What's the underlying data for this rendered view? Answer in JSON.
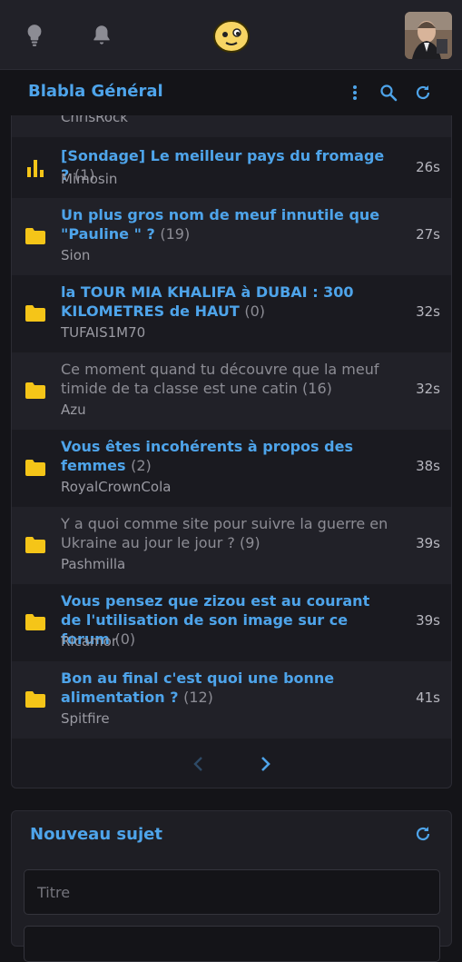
{
  "header": {
    "logo_icon": "smiley-face-icon",
    "idea_icon": "lightbulb-icon",
    "notif_icon": "bell-icon",
    "avatar": "user-avatar"
  },
  "forum": {
    "title": "Blabla Général",
    "menu_icon": "more-vertical-icon",
    "search_icon": "search-icon",
    "refresh_icon": "refresh-icon"
  },
  "topics": [
    {
      "icon": "folder-icon",
      "title": "",
      "count": "",
      "author": "ChrisRock",
      "time": "",
      "visited": false,
      "partial": true
    },
    {
      "icon": "poll-icon",
      "title": "[Sondage] Le meilleur pays du fromage ?",
      "count": "(1)",
      "author": "Mimosin",
      "time": "26s",
      "visited": false
    },
    {
      "icon": "folder-icon",
      "title": "Un plus gros nom de meuf innutile que \"Pauline \" ?",
      "count": "(19)",
      "author": "Sion",
      "time": "27s",
      "visited": false
    },
    {
      "icon": "folder-icon",
      "title": "la TOUR MIA KHALIFA à DUBAI : 300 KILOMETRES de HAUT",
      "count": "(0)",
      "author": "TUFAIS1M70",
      "time": "32s",
      "visited": false
    },
    {
      "icon": "folder-icon",
      "title": "Ce moment quand tu découvre que la meuf timide de ta classe est une catin",
      "count": "(16)",
      "author": "Azu",
      "time": "32s",
      "visited": true
    },
    {
      "icon": "folder-icon",
      "title": "Vous êtes incohérents à propos des femmes",
      "count": "(2)",
      "author": "RoyalCrownCola",
      "time": "38s",
      "visited": false
    },
    {
      "icon": "folder-icon",
      "title": "Y a quoi comme site pour suivre la guerre en Ukraine au jour le jour ?",
      "count": "(9)",
      "author": "Pashmilla",
      "time": "39s",
      "visited": true
    },
    {
      "icon": "folder-icon",
      "title": "Vous pensez que zizou est au courant de l'utilisation de son image sur ce forum",
      "count": "(0)",
      "author": "Ricamor",
      "time": "39s",
      "visited": false
    },
    {
      "icon": "folder-icon",
      "title": "Bon au final c'est quoi une bonne alimentation ?",
      "count": "(12)",
      "author": "Spitfire",
      "time": "41s",
      "visited": false
    }
  ],
  "pager": {
    "prev_icon": "chevron-left-icon",
    "next_icon": "chevron-right-icon"
  },
  "new_topic": {
    "title": "Nouveau sujet",
    "placeholder": "Titre",
    "refresh_icon": "refresh-icon"
  },
  "colors": {
    "accent": "#4ea4ea",
    "folder": "#f5c518",
    "bg": "#141418",
    "row_alt": "#212128"
  }
}
